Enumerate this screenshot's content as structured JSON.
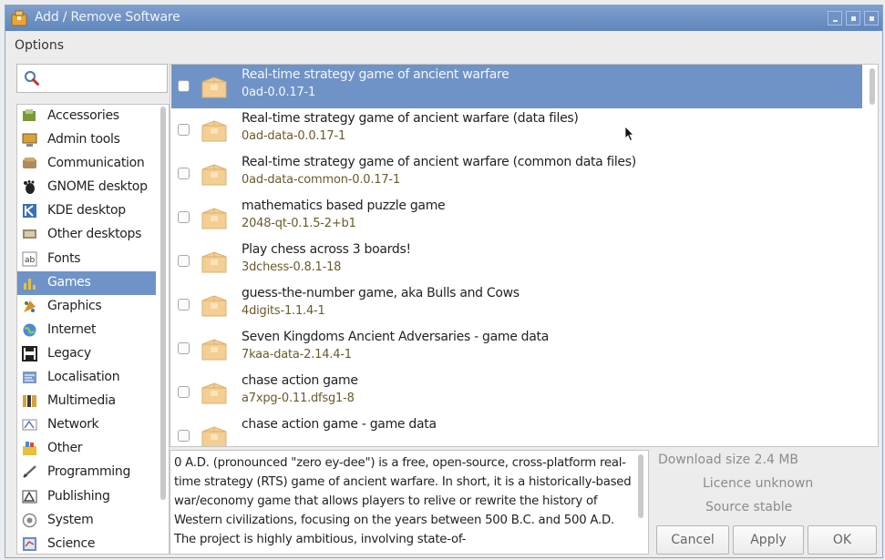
{
  "window": {
    "title": "Add / Remove Software",
    "accent_color": "#6f93c6"
  },
  "menubar": {
    "options_label": "Options"
  },
  "search": {
    "value": "",
    "icon": "search-icon"
  },
  "categories": [
    {
      "label": "Accessories",
      "icon": "accessories-icon"
    },
    {
      "label": "Admin tools",
      "icon": "admin-tools-icon"
    },
    {
      "label": "Communication",
      "icon": "communication-icon"
    },
    {
      "label": "GNOME desktop",
      "icon": "gnome-icon"
    },
    {
      "label": "KDE desktop",
      "icon": "kde-icon"
    },
    {
      "label": "Other desktops",
      "icon": "other-desktops-icon"
    },
    {
      "label": "Fonts",
      "icon": "fonts-icon"
    },
    {
      "label": "Games",
      "icon": "games-icon",
      "selected": true
    },
    {
      "label": "Graphics",
      "icon": "graphics-icon"
    },
    {
      "label": "Internet",
      "icon": "internet-icon"
    },
    {
      "label": "Legacy",
      "icon": "legacy-icon"
    },
    {
      "label": "Localisation",
      "icon": "localisation-icon"
    },
    {
      "label": "Multimedia",
      "icon": "multimedia-icon"
    },
    {
      "label": "Network",
      "icon": "network-icon"
    },
    {
      "label": "Other",
      "icon": "other-icon"
    },
    {
      "label": "Programming",
      "icon": "programming-icon"
    },
    {
      "label": "Publishing",
      "icon": "publishing-icon"
    },
    {
      "label": "System",
      "icon": "system-icon"
    },
    {
      "label": "Science",
      "icon": "science-icon"
    }
  ],
  "packages": [
    {
      "description": "Real-time strategy game of ancient warfare",
      "name": "0ad-0.0.17-1",
      "checked": false,
      "selected": true
    },
    {
      "description": "Real-time strategy game of ancient warfare (data files)",
      "name": "0ad-data-0.0.17-1",
      "checked": false
    },
    {
      "description": "Real-time strategy game of ancient warfare (common data files)",
      "name": "0ad-data-common-0.0.17-1",
      "checked": false
    },
    {
      "description": "mathematics based puzzle game",
      "name": "2048-qt-0.1.5-2+b1",
      "checked": false
    },
    {
      "description": "Play chess across 3 boards!",
      "name": "3dchess-0.8.1-18",
      "checked": false
    },
    {
      "description": "guess-the-number game, aka Bulls and Cows",
      "name": "4digits-1.1.4-1",
      "checked": false
    },
    {
      "description": "Seven Kingdoms Ancient Adversaries - game data",
      "name": "7kaa-data-2.14.4-1",
      "checked": false
    },
    {
      "description": "chase action game",
      "name": "a7xpg-0.11.dfsg1-8",
      "checked": false
    },
    {
      "description": "chase action game - game data",
      "name": "",
      "checked": false
    }
  ],
  "details": {
    "description": "0 A.D. (pronounced \"zero ey-dee\") is a free, open-source, cross-platform real-time strategy (RTS) game of ancient warfare. In short, it is a historically-based war/economy game that allows players to relive or rewrite the history of Western civilizations, focusing on the years between 500 B.C. and 500 A.D. The project is highly ambitious, involving state-of-",
    "download_size_label": "Download size",
    "download_size_value": "2.4 MB",
    "licence_label": "Licence",
    "licence_value": "unknown",
    "source_label": "Source",
    "source_value": "stable"
  },
  "buttons": {
    "cancel": "Cancel",
    "apply": "Apply",
    "ok": "OK"
  }
}
